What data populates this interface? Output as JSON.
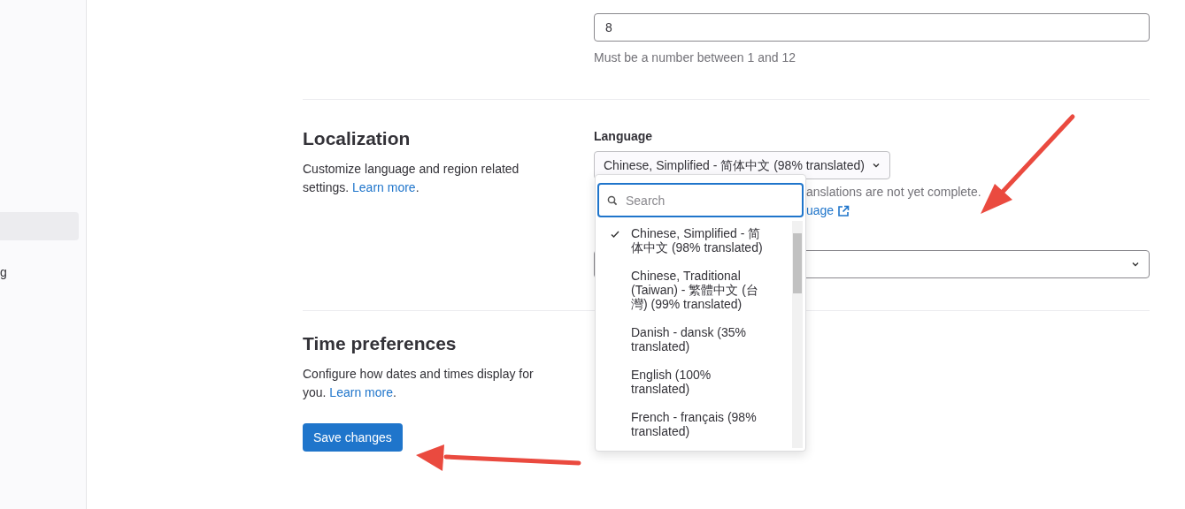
{
  "sidebar": {
    "items": [
      {
        "selected": true
      },
      {
        "label": "g",
        "selected": false
      }
    ]
  },
  "tab_width": {
    "value": "8",
    "help": "Must be a number between 1 and 12"
  },
  "localization": {
    "title": "Localization",
    "description": "Customize language and region related settings.",
    "link": "Learn more",
    "link_suffix": ".",
    "language": {
      "label": "Language",
      "value": "Chinese, Simplified - 简体中文 (98% translated)",
      "help": "anslations are not yet complete.",
      "help_link": "uage",
      "dropdown": {
        "search_placeholder": "Search",
        "options": [
          {
            "label": "Chinese, Simplified - 简体中文 (98% translated)",
            "selected": true
          },
          {
            "label": "Chinese, Traditional (Taiwan) - 繁體中文 (台灣) (99% translated)",
            "selected": false
          },
          {
            "label": "Danish - dansk (35% translated)",
            "selected": false
          },
          {
            "label": "English (100% translated)",
            "selected": false
          },
          {
            "label": "French - français (98% translated)",
            "selected": false
          }
        ]
      }
    }
  },
  "time_preferences": {
    "title": "Time preferences",
    "description": "Configure how dates and times display for you.",
    "link": "Learn more",
    "link_suffix": "."
  },
  "save_button": "Save changes"
}
